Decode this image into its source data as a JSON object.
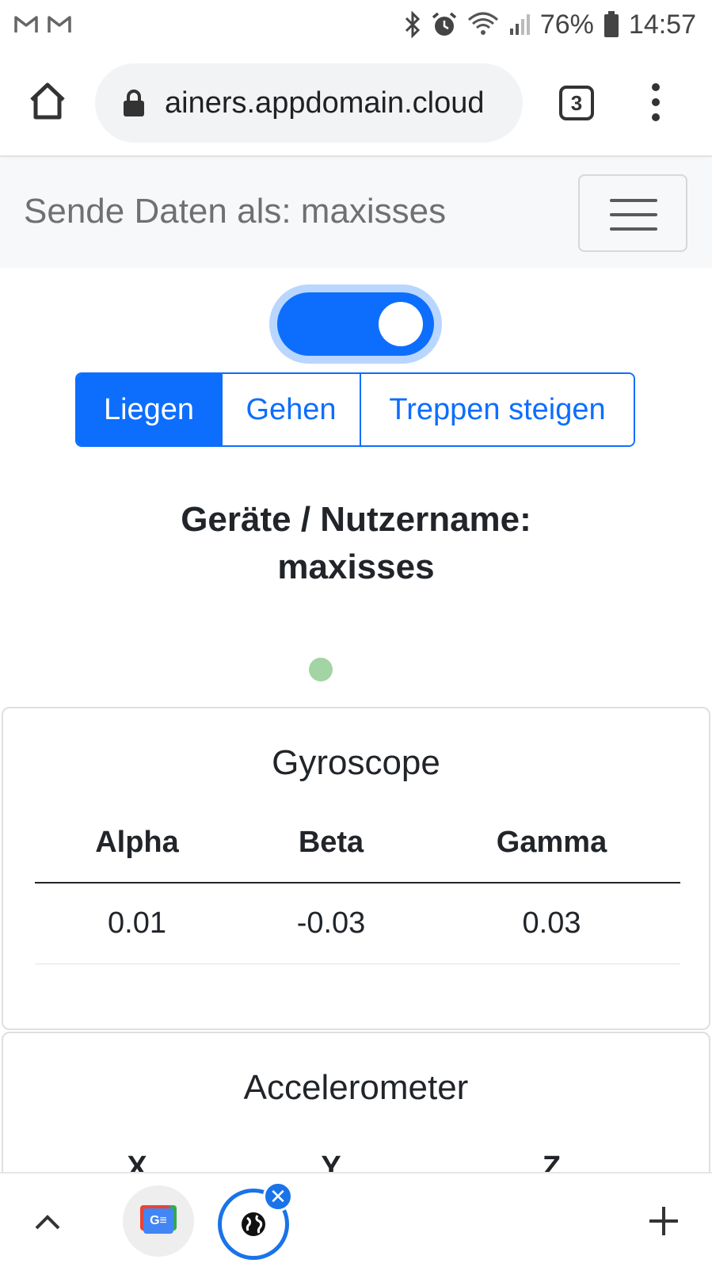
{
  "status_bar": {
    "left_icons": [
      "gmail-icon",
      "gmail-icon"
    ],
    "right_icons": [
      "bluetooth-icon",
      "alarm-icon",
      "wifi-icon",
      "signal-icon",
      "battery-icon"
    ],
    "battery_percent": "76%",
    "time": "14:57"
  },
  "browser": {
    "url": "ainers.appdomain.cloud",
    "tab_count": "3"
  },
  "navbar": {
    "brand": "Sende Daten als: maxisses"
  },
  "toggle": {
    "on": true
  },
  "activity": {
    "options": [
      "Liegen",
      "Gehen",
      "Treppen steigen"
    ],
    "selected": "Liegen"
  },
  "device": {
    "heading_line1": "Geräte / Nutzername:",
    "heading_line2": "maxisses"
  },
  "gyroscope": {
    "title": "Gyroscope",
    "headers": [
      "Alpha",
      "Beta",
      "Gamma"
    ],
    "values": [
      "0.01",
      "-0.03",
      "0.03"
    ]
  },
  "accelerometer": {
    "title": "Accelerometer",
    "headers": [
      "X",
      "Y",
      "Z"
    ]
  },
  "bottom_bar": {
    "tab1_label": "G≡",
    "close_glyph": "✕"
  },
  "colors": {
    "primary": "#0d6efd",
    "status_dot": "#a3d4a3",
    "chrome_blue": "#1a73e8"
  }
}
